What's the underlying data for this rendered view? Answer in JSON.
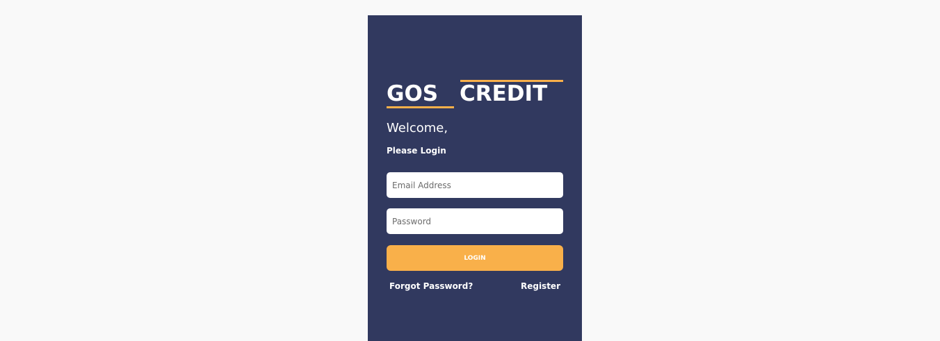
{
  "brand": {
    "word1": "GOS",
    "word2": "CREDIT",
    "accent_color": "#f9b04a",
    "panel_color": "#31395f"
  },
  "login": {
    "welcome": "Welcome,",
    "subtitle": "Please Login",
    "email_placeholder": "Email Address",
    "password_placeholder": "Password",
    "login_label": "LOGIN",
    "forgot_label": "Forgot Password?",
    "register_label": "Register"
  }
}
